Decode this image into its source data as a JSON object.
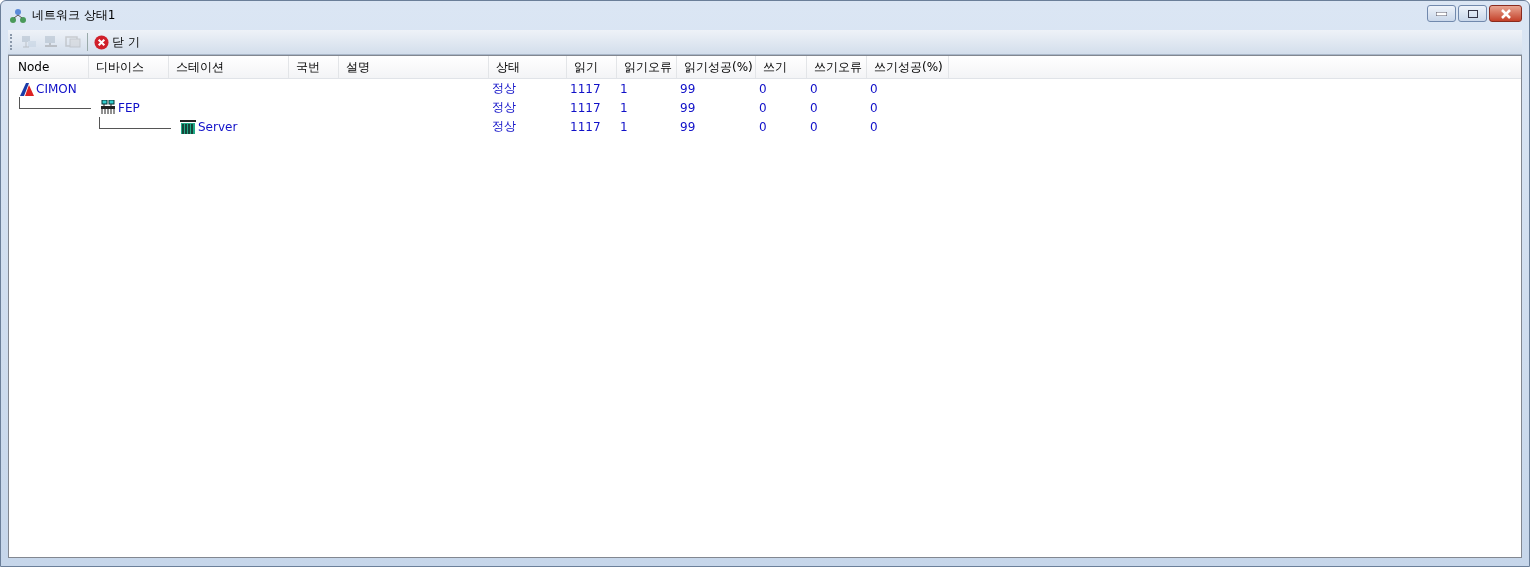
{
  "window": {
    "title": "네트워크 상태1"
  },
  "toolbar": [
    {
      "kind": "connect",
      "disabled": true
    },
    {
      "kind": "disconnect",
      "disabled": true
    },
    {
      "kind": "refresh",
      "disabled": true
    },
    {
      "kind": "close",
      "label": "닫 기",
      "disabled": false
    }
  ],
  "table": {
    "columns": [
      "Node",
      "디바이스",
      "스테이션",
      "국번",
      "설명",
      "상태",
      "읽기",
      "읽기오류",
      "읽기성공(%)",
      "쓰기",
      "쓰기오류",
      "쓰기성공(%)"
    ],
    "rows": [
      {
        "kind": "node",
        "name": "CIMON",
        "values": [
          "정상",
          "1117",
          "1",
          "99",
          "0",
          "0",
          "0"
        ],
        "children": [
          {
            "kind": "device",
            "name": "FEP",
            "values": [
              "정상",
              "1117",
              "1",
              "99",
              "0",
              "0",
              "0"
            ],
            "children": [
              {
                "kind": "station",
                "name": "Server",
                "values": [
                  "정상",
                  "1117",
                  "1",
                  "99",
                  "0",
                  "0",
                  "0"
                ]
              }
            ]
          }
        ]
      }
    ]
  }
}
